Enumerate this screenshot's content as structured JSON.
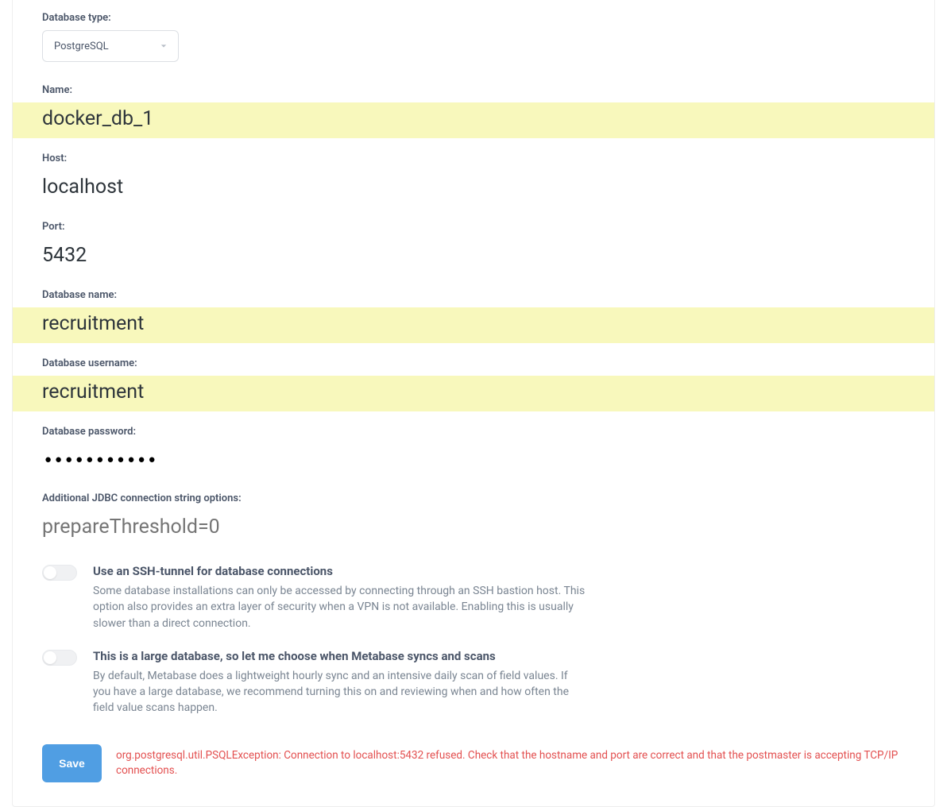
{
  "form": {
    "database_type": {
      "label": "Database type:",
      "value": "PostgreSQL"
    },
    "name": {
      "label": "Name:",
      "value": "docker_db_1"
    },
    "host": {
      "label": "Host:",
      "value": "localhost"
    },
    "port": {
      "label": "Port:",
      "value": "5432"
    },
    "database_name": {
      "label": "Database name:",
      "value": "recruitment"
    },
    "username": {
      "label": "Database username:",
      "value": "recruitment"
    },
    "password": {
      "label": "Database password:",
      "value": "●●●●●●●●●●●"
    },
    "jdbc": {
      "label": "Additional JDBC connection string options:",
      "placeholder": "prepareThreshold=0"
    },
    "ssh_tunnel": {
      "title": "Use an SSH-tunnel for database connections",
      "desc": "Some database installations can only be accessed by connecting through an SSH bastion host. This option also provides an extra layer of security when a VPN is not available. Enabling this is usually slower than a direct connection.",
      "enabled": false
    },
    "large_db": {
      "title": "This is a large database, so let me choose when Metabase syncs and scans",
      "desc": "By default, Metabase does a lightweight hourly sync and an intensive daily scan of field values. If you have a large database, we recommend turning this on and reviewing when and how often the field value scans happen.",
      "enabled": false
    },
    "save_button": "Save",
    "error": "org.postgresql.util.PSQLException: Connection to localhost:5432 refused. Check that the hostname and port are correct and that the postmaster is accepting TCP/IP connections."
  }
}
